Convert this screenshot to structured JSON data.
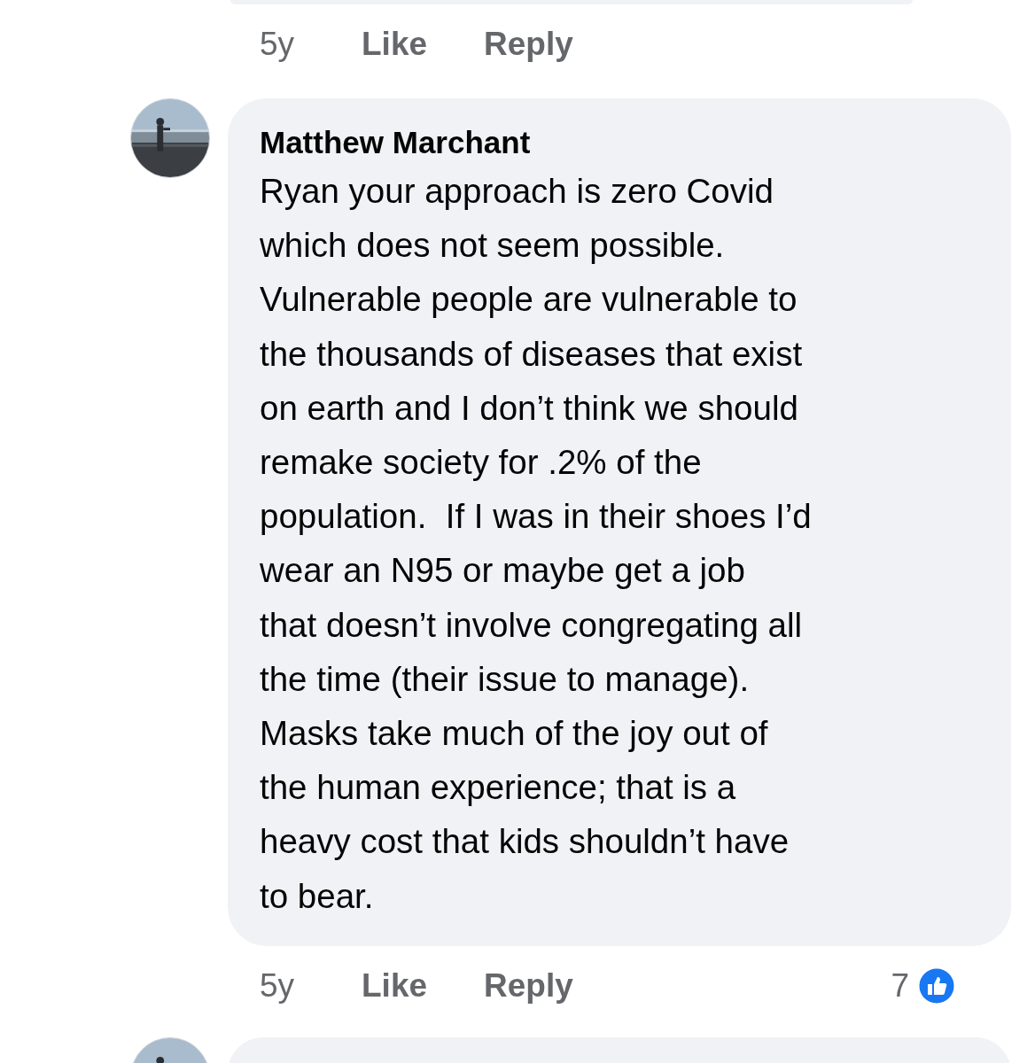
{
  "previous_comment": {
    "actions": {
      "time": "5y",
      "like": "Like",
      "reply": "Reply"
    }
  },
  "comment": {
    "author": "Matthew Marchant",
    "text": "Ryan your approach is zero Covid\nwhich does not seem possible.\nVulnerable people are vulnerable to\nthe thousands of diseases that exist\non earth and I don’t think we should\nremake society for .2% of the\npopulation.  If I was in their shoes I’d\nwear an N95 or maybe get a job\nthat doesn’t involve congregating all\nthe time (their issue to manage).\nMasks take much of the joy out of\nthe human experience; that is a\nheavy cost that kids shouldn’t have\nto bear.",
    "actions": {
      "time": "5y",
      "like": "Like",
      "reply": "Reply"
    },
    "reaction_count": "7"
  }
}
